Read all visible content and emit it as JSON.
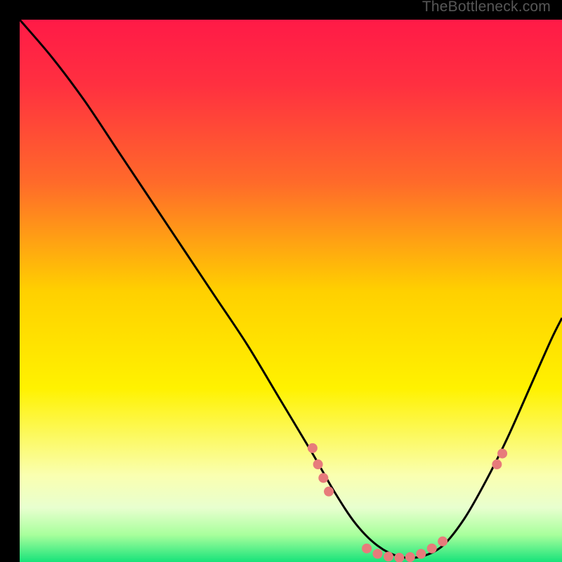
{
  "watermark": "TheBottleneck.com",
  "chart_data": {
    "type": "line",
    "title": "",
    "xlabel": "",
    "ylabel": "",
    "xlim": [
      0,
      100
    ],
    "ylim": [
      0,
      100
    ],
    "gradient_stops": [
      {
        "offset": 0.0,
        "color": "#ff1a47"
      },
      {
        "offset": 0.12,
        "color": "#ff3040"
      },
      {
        "offset": 0.3,
        "color": "#ff6a2a"
      },
      {
        "offset": 0.5,
        "color": "#ffd000"
      },
      {
        "offset": 0.68,
        "color": "#fff200"
      },
      {
        "offset": 0.84,
        "color": "#faffb0"
      },
      {
        "offset": 0.9,
        "color": "#e8ffcf"
      },
      {
        "offset": 0.95,
        "color": "#a8ff9c"
      },
      {
        "offset": 1.0,
        "color": "#17e37a"
      }
    ],
    "series": [
      {
        "name": "bottleneck-curve",
        "x": [
          0,
          6,
          12,
          18,
          24,
          30,
          36,
          42,
          48,
          54,
          58,
          62,
          66,
          70,
          74,
          78,
          82,
          86,
          90,
          94,
          98,
          100
        ],
        "y": [
          100,
          93,
          85,
          76,
          67,
          58,
          49,
          40,
          30,
          20,
          13,
          7,
          3,
          1,
          1,
          3,
          8,
          15,
          23,
          32,
          41,
          45
        ]
      }
    ],
    "markers": [
      {
        "x": 54,
        "y": 21
      },
      {
        "x": 55,
        "y": 18
      },
      {
        "x": 56,
        "y": 15.5
      },
      {
        "x": 57,
        "y": 13
      },
      {
        "x": 64,
        "y": 2.5
      },
      {
        "x": 66,
        "y": 1.5
      },
      {
        "x": 68,
        "y": 1.0
      },
      {
        "x": 70,
        "y": 0.8
      },
      {
        "x": 72,
        "y": 0.9
      },
      {
        "x": 74,
        "y": 1.5
      },
      {
        "x": 76,
        "y": 2.5
      },
      {
        "x": 78,
        "y": 3.8
      },
      {
        "x": 88,
        "y": 18
      },
      {
        "x": 89,
        "y": 20
      }
    ],
    "marker_color": "#e77b7b",
    "curve_color": "#000000"
  }
}
